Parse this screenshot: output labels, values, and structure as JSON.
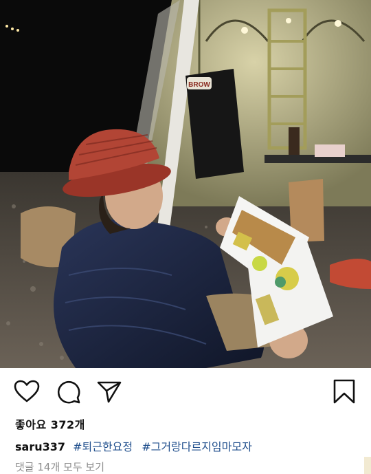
{
  "post": {
    "image_alt": "Person in red hat and navy down jacket reading a tent catalog at a night campsite",
    "actions": {
      "like_icon": "heart-outline",
      "comment_icon": "speech-bubble",
      "share_icon": "paper-plane",
      "save_icon": "bookmark"
    },
    "likes_text": "좋아요 372개",
    "caption": {
      "username": "saru337",
      "hashtags": [
        "#퇴근한요정",
        "#그거랑다르지임마모자"
      ]
    },
    "view_comments": "댓글 14개 모두 보기"
  },
  "photo_text": {
    "chair_brand": "BROW"
  },
  "colors": {
    "text": "#111111",
    "hashtag": "#1f4e8c",
    "muted": "#8e8e8e",
    "hat": "#a63b2f",
    "jacket": "#1b2540"
  }
}
